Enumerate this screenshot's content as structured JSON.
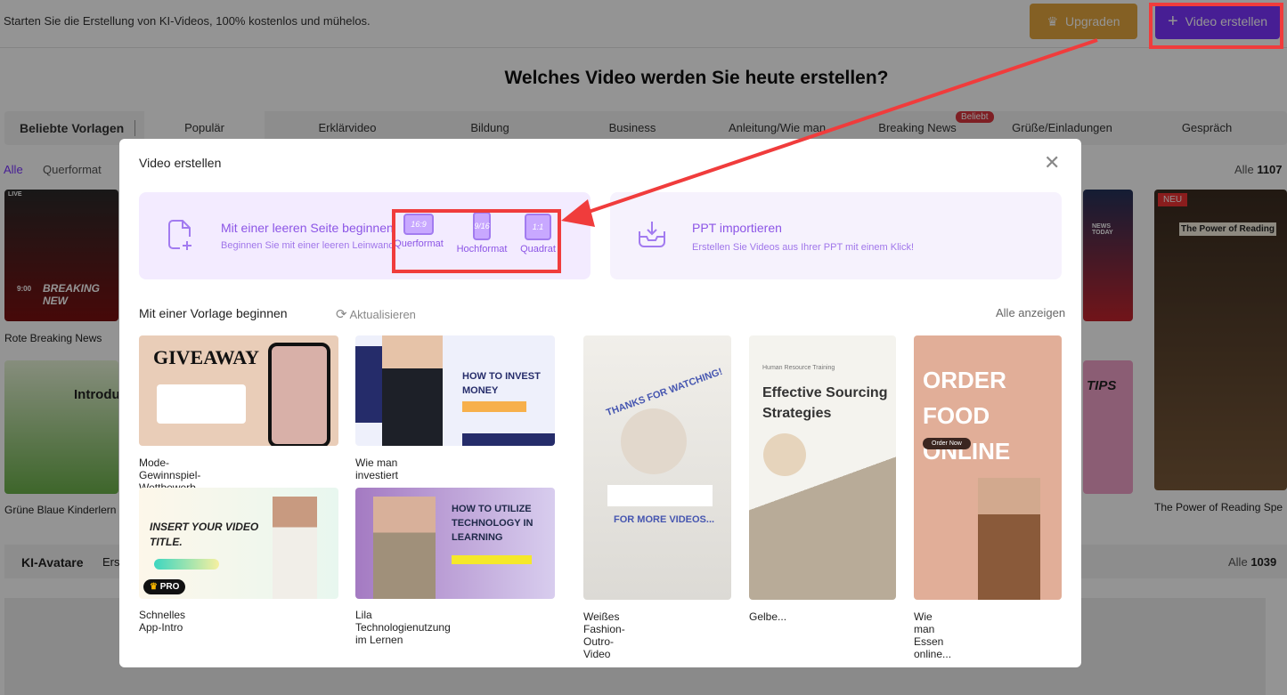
{
  "topbar": {
    "message": "Starten Sie die Erstellung von KI-Videos, 100% kostenlos und mühelos.",
    "upgrade_label": "Upgraden",
    "create_label": "Video erstellen"
  },
  "page": {
    "heading": "Welches Video werden Sie heute erstellen?",
    "tabs_title": "Beliebte Vorlagen",
    "tabs": [
      "Populär",
      "Erklärvideo",
      "Bildung",
      "Business",
      "Anleitung/Wie man",
      "Breaking News",
      "Grüße/Einladungen",
      "Gespräch"
    ],
    "badge": "Beliebt",
    "filters": [
      "Alle",
      "Querformat"
    ],
    "count_label": "Alle",
    "count": "1107",
    "bg_cards": [
      "Rote Breaking News",
      "Grüne Blaue Kinderlern",
      "The Power of Reading Spe"
    ],
    "bg_thumb_texts": {
      "breaking": "BREAKING NEW",
      "time": "9:00",
      "live": "LIVE",
      "intro": "Introdu",
      "new": "NEU",
      "reading": "The Power of Reading",
      "news_today": "NEWS TODAY",
      "tips": "TIPS"
    },
    "avatars_title": "KI-Avatare",
    "avatars_tab": "Ers",
    "avatars_count_label": "Alle",
    "avatars_count": "1039"
  },
  "modal": {
    "title": "Video erstellen",
    "blank": {
      "title": "Mit einer leeren Seite beginnen",
      "subtitle": "Beginnen Sie mit einer leeren Leinwand",
      "formats": [
        {
          "ratio": "16:9",
          "label": "Querformat"
        },
        {
          "ratio": "9/16",
          "label": "Hochformat"
        },
        {
          "ratio": "1:1",
          "label": "Quadrat"
        }
      ]
    },
    "ppt": {
      "title": "PPT importieren",
      "subtitle": "Erstellen Sie Videos aus Ihrer PPT mit einem Klick!"
    },
    "templates_title": "Mit einer Vorlage beginnen",
    "refresh_label": "Aktualisieren",
    "show_all_label": "Alle anzeigen",
    "templates": [
      {
        "name": "Mode-Gewinnspiel-Wettbewerb",
        "headline": "GIVEAWAY"
      },
      {
        "name": "Wie man investiert",
        "headline": "HOW TO INVEST MONEY"
      },
      {
        "name": "Schnelles App-Intro",
        "headline": "INSERT YOUR VIDEO TITLE.",
        "badge": "PRO"
      },
      {
        "name": "Lila Technologienutzung im Lernen",
        "headline": "HOW TO UTILIZE TECHNOLOGY IN LEARNING"
      },
      {
        "name": "Weißes Fashion-Outro-Video",
        "headline": "THANKS FOR WATCHING!",
        "sub": "FOR MORE VIDEOS..."
      },
      {
        "name": "Gelbe...",
        "headline": "Effective Sourcing Strategies",
        "sub": "Human Resource Training"
      },
      {
        "name": "Wie man Essen online...",
        "headline": "ORDER FOOD ONLINE",
        "sub": "Order Now"
      }
    ]
  },
  "colors": {
    "accent": "#7a35ff",
    "upgrade": "#e3a53f",
    "annotation": "#f03c3c"
  }
}
